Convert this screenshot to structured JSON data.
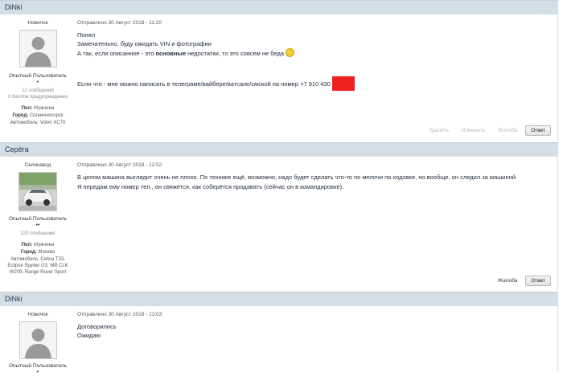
{
  "posts": [
    {
      "author": "DiNki",
      "rank": "Новичок",
      "group": "Опытный Пользователь",
      "pips": "•",
      "stats": [
        "12 сообщений",
        "0 баллов предупреждения"
      ],
      "fields": [
        {
          "key": "Пол:",
          "value": "Мужчина"
        },
        {
          "key": "Город:",
          "value": "Солнечногорск"
        },
        {
          "key": "Автомобиль:",
          "value": "Volvo XC70"
        }
      ],
      "meta": "Отправлено 30 Август 2018 - 11:20",
      "lines": [
        "Понял",
        "Замечательно, буду ожидать VIN и фотографии"
      ],
      "line3_pre": "А так, если описанное - это ",
      "line3_bold": "основные",
      "line3_post": " недостатки, то это совсем не беда",
      "line_phone": "Если что - мне можно написать в телеграме/вайбере/ватсапе/смской на номер +7 910 430",
      "actions": [
        "Удалить",
        "Изменить",
        "Жалоба"
      ],
      "reply": "Ответ"
    },
    {
      "author": "Серёга",
      "rank": "Селикавод",
      "group": "Опытный Пользователь",
      "pips": "••",
      "stats": [
        "220 сообщений"
      ],
      "fields": [
        {
          "key": "Пол:",
          "value": "Мужчина"
        },
        {
          "key": "Город:",
          "value": "Москва"
        },
        {
          "key": "Автомобиль:",
          "value": "Celica T23, Eclipse Spyder G3, MB CLK W209, Range Rover Sport"
        }
      ],
      "meta": "Отправлено 30 Август 2018 - 12:52",
      "lines": [
        "В целом машина выглядит очень не плохо. По технике ещё, возможно, надо будет сделать что-то по мелочи по ходовке, но вообще, он следил за машиной.",
        "Я передам ему номер тел., он свяжется, как соберётся продавать (сейчас он в командировке)."
      ],
      "actions": [
        "Жалоба"
      ],
      "reply": "Ответ"
    },
    {
      "author": "DiNki",
      "rank": "Новичок",
      "group": "Опытный Пользователь",
      "pips": "•",
      "meta": "Отправлено 30 Август 2018 - 13:03",
      "lines": [
        "Договорились",
        "Ожидаю"
      ]
    }
  ]
}
